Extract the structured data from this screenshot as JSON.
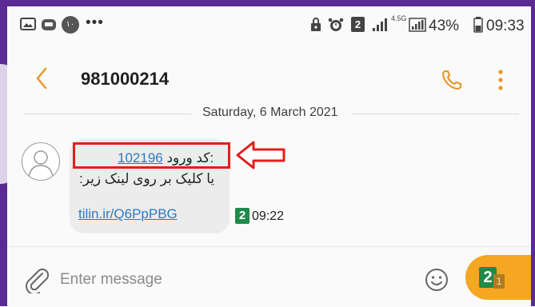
{
  "status_bar": {
    "notification_badge": "۱۰",
    "more": "•••",
    "sim": "2",
    "network": "4.5G",
    "battery": "43%",
    "time": "09:33"
  },
  "header": {
    "title": "981000214",
    "back_icon": "chevron-left-icon",
    "call_icon": "phone-icon",
    "menu_icon": "more-vertical-icon"
  },
  "conversation": {
    "date": "Saturday, 6 March 2021",
    "message": {
      "label": "کد ورود:",
      "code": "102196",
      "line2": "یا کلیک بر روی لینک زیر:",
      "link": "tilin.ir/Q6PpPBG",
      "sim": "2",
      "time": "09:22"
    }
  },
  "input": {
    "placeholder": "Enter message",
    "send_sim": "2",
    "send_sub": "1"
  },
  "colors": {
    "accent": "#f5a623",
    "link": "#2a7ac6",
    "highlight": "#e31d1d",
    "sim_badge": "#1f8a4a"
  }
}
